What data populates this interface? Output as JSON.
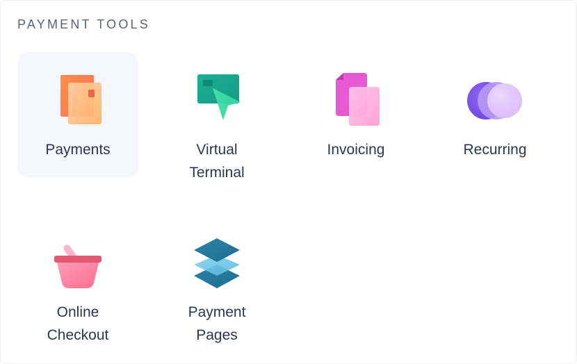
{
  "section": {
    "title": "PAYMENT TOOLS"
  },
  "tools": [
    {
      "id": "payments",
      "label": "Payments",
      "icon": "card-icon",
      "selected": true
    },
    {
      "id": "virtual-terminal",
      "label": "Virtual\nTerminal",
      "icon": "terminal-pointer-icon",
      "selected": false
    },
    {
      "id": "invoicing",
      "label": "Invoicing",
      "icon": "documents-icon",
      "selected": false
    },
    {
      "id": "recurring",
      "label": "Recurring",
      "icon": "circles-icon",
      "selected": false
    },
    {
      "id": "online-checkout",
      "label": "Online\nCheckout",
      "icon": "basket-icon",
      "selected": false
    },
    {
      "id": "payment-pages",
      "label": "Payment\nPages",
      "icon": "layers-icon",
      "selected": false
    }
  ]
}
